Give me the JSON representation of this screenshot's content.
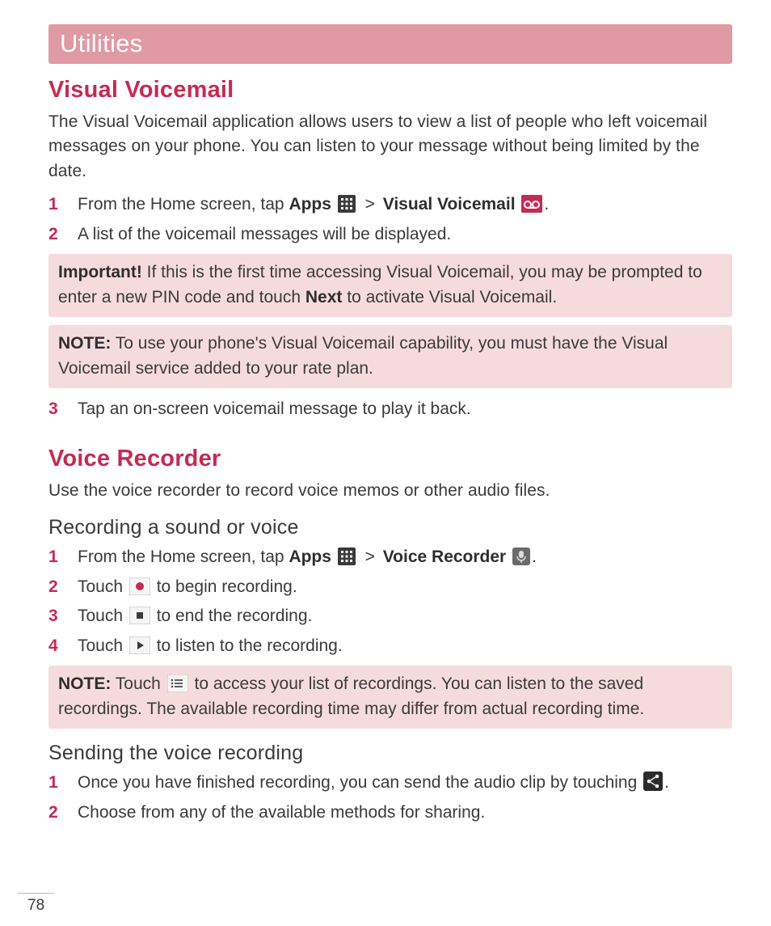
{
  "chapter": "Utilities",
  "pageNumber": "78",
  "vv": {
    "heading": "Visual Voicemail",
    "intro": "The Visual Voicemail application allows users to view a list of people who left voicemail messages on your phone. You can listen to your message without being limited by the date.",
    "step1_a": "From the Home screen, tap ",
    "step1_apps": "Apps",
    "step1_gt": " > ",
    "step1_vv": "Visual Voicemail",
    "step1_end": ".",
    "step2": "A list of the voicemail messages will be displayed.",
    "important_label": "Important!",
    "important_a": " If this is the first time accessing Visual Voicemail, you may be prompted to enter a new PIN code and touch ",
    "important_next": "Next",
    "important_b": " to activate Visual Voicemail.",
    "note_label": "NOTE:",
    "note_text": " To use your phone's Visual Voicemail capability, you must have the Visual Voicemail service added to your rate plan.",
    "step3": "Tap an on-screen voicemail message to play it back."
  },
  "vr": {
    "heading": "Voice Recorder",
    "intro": "Use the voice recorder to record voice memos or other audio files.",
    "sub1": "Recording a sound or voice",
    "s1_a": "From the Home screen, tap ",
    "s1_apps": "Apps",
    "s1_gt": " > ",
    "s1_vr": "Voice Recorder",
    "s1_end": ".",
    "s2_a": "Touch ",
    "s2_b": " to begin recording.",
    "s3_a": "Touch ",
    "s3_b": " to end the recording.",
    "s4_a": "Touch ",
    "s4_b": " to listen to the recording.",
    "note_label": "NOTE:",
    "note_a": " Touch ",
    "note_b": " to access your list of recordings. You can listen to the saved recordings. The available recording time may differ from actual recording time.",
    "sub2": "Sending the voice recording",
    "send1_a": "Once you have finished recording, you can send the audio clip by touching ",
    "send1_b": ".",
    "send2": "Choose from any of the available methods for sharing."
  },
  "nums": {
    "n1": "1",
    "n2": "2",
    "n3": "3",
    "n4": "4"
  }
}
